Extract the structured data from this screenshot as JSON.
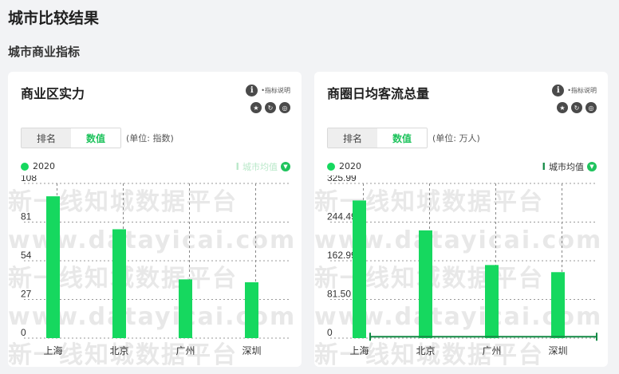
{
  "page": {
    "title": "城市比较结果",
    "section": "城市商业指标"
  },
  "cards": [
    {
      "title": "商业区实力",
      "info": {
        "text": "•指标说明"
      },
      "tools": [
        "star-icon",
        "refresh-icon",
        "eye-icon"
      ],
      "tabs": {
        "rank": "排名",
        "value": "数值"
      },
      "unit": "(单位: 指数)",
      "legend": "2020",
      "avg_label": "城市均值",
      "avg_active": false,
      "watermark": [
        "新一线知城数据平台",
        "www.datayicai.com",
        "新一线知城数据平台",
        "www.datayicai.com",
        "新一线知城数据平台"
      ]
    },
    {
      "title": "商圈日均客流总量",
      "info": {
        "text": "•指标说明"
      },
      "tools": [
        "star-icon",
        "refresh-icon",
        "eye-icon"
      ],
      "tabs": {
        "rank": "排名",
        "value": "数值"
      },
      "unit": "(单位: 万人)",
      "legend": "2020",
      "avg_label": "城市均值",
      "avg_active": true,
      "watermark": [
        "新一线知城数据平台",
        "www.datayicai.com",
        "新一线知城数据平台",
        "www.datayicai.com",
        "新一线知城数据平台"
      ]
    }
  ],
  "chart_data": [
    {
      "type": "bar",
      "categories": [
        "上海",
        "北京",
        "广州",
        "深圳"
      ],
      "series": [
        {
          "name": "2020",
          "values": [
            99,
            76,
            41,
            39
          ]
        }
      ],
      "yticks": [
        "108",
        "81",
        "54",
        "27",
        "0"
      ],
      "ylim": [
        0,
        108
      ],
      "average": null,
      "color": "#16d85f"
    },
    {
      "type": "bar",
      "categories": [
        "上海",
        "北京",
        "广州",
        "深圳"
      ],
      "series": [
        {
          "name": "2020",
          "values": [
            290,
            227,
            154,
            139
          ]
        }
      ],
      "yticks": [
        "325.99",
        "244.49",
        "162.99",
        "81.50",
        "0"
      ],
      "ylim": [
        0,
        325.99
      ],
      "average": 3,
      "color": "#16d85f"
    }
  ]
}
